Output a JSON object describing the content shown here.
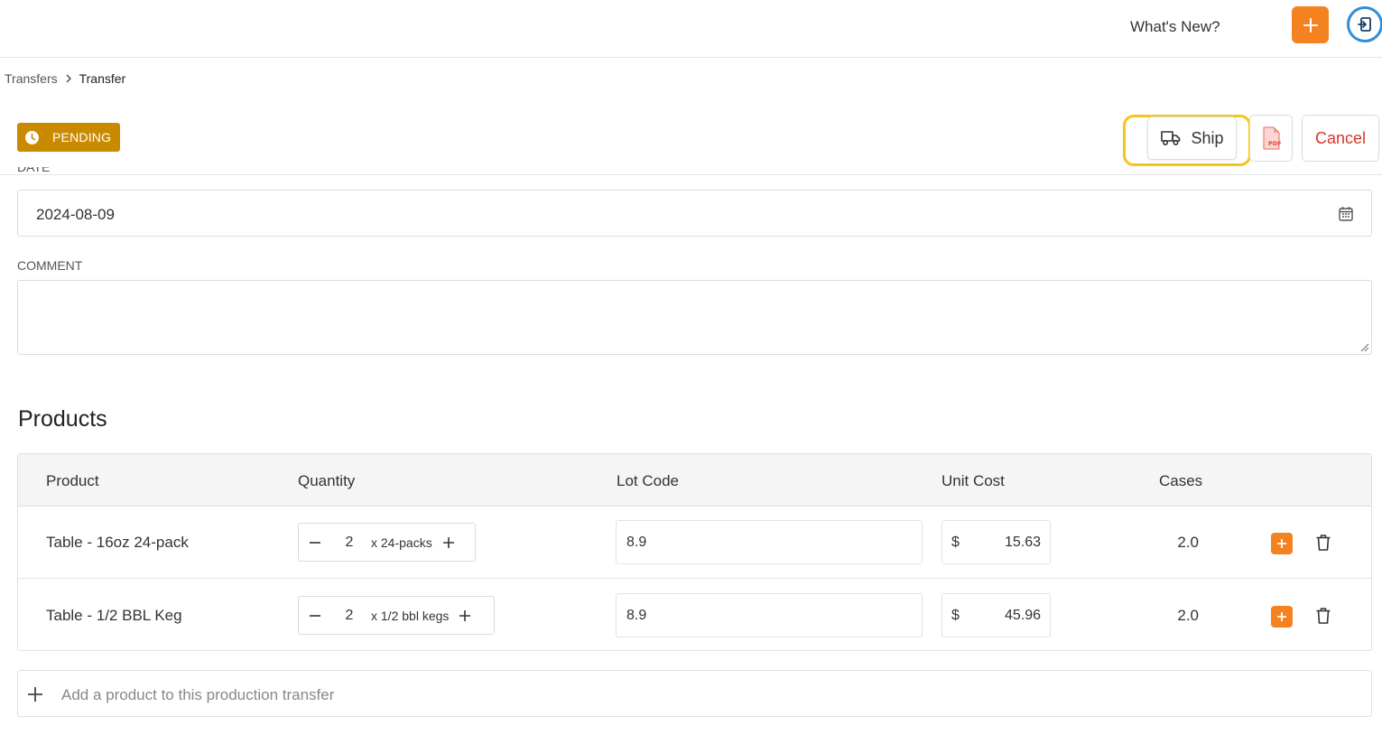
{
  "header": {
    "whats_new": "What's New?",
    "add_button_icon": "plus-icon",
    "avatar_icon": "user-badge-icon",
    "accent_color": "#f58220"
  },
  "breadcrumb": {
    "parent": "Transfers",
    "current": "Transfer"
  },
  "status": {
    "label": "PENDING",
    "color": "#c98a00",
    "icon": "clock-icon"
  },
  "actions": {
    "ship_label": "Ship",
    "ship_icon": "truck-icon",
    "pdf_icon": "pdf-file-icon",
    "cancel_label": "Cancel",
    "cancel_color": "#d9362b"
  },
  "form": {
    "date_label": "DATE",
    "date_value": "2024-08-09",
    "comment_label": "COMMENT",
    "comment_value": ""
  },
  "products": {
    "title": "Products",
    "columns": [
      "Product",
      "Quantity",
      "Lot Code",
      "Unit Cost",
      "Cases"
    ],
    "rows": [
      {
        "product": "Table - 16oz 24-pack",
        "quantity": "2",
        "unit": "x 24-packs",
        "lot_code": "8.9",
        "currency": "$",
        "unit_cost": "15.63",
        "cases": "2.0"
      },
      {
        "product": "Table - 1/2 BBL Keg",
        "quantity": "2",
        "unit": "x 1/2 bbl kegs",
        "lot_code": "8.9",
        "currency": "$",
        "unit_cost": "45.96",
        "cases": "2.0"
      }
    ],
    "add_placeholder": "Add a product to this production transfer"
  }
}
